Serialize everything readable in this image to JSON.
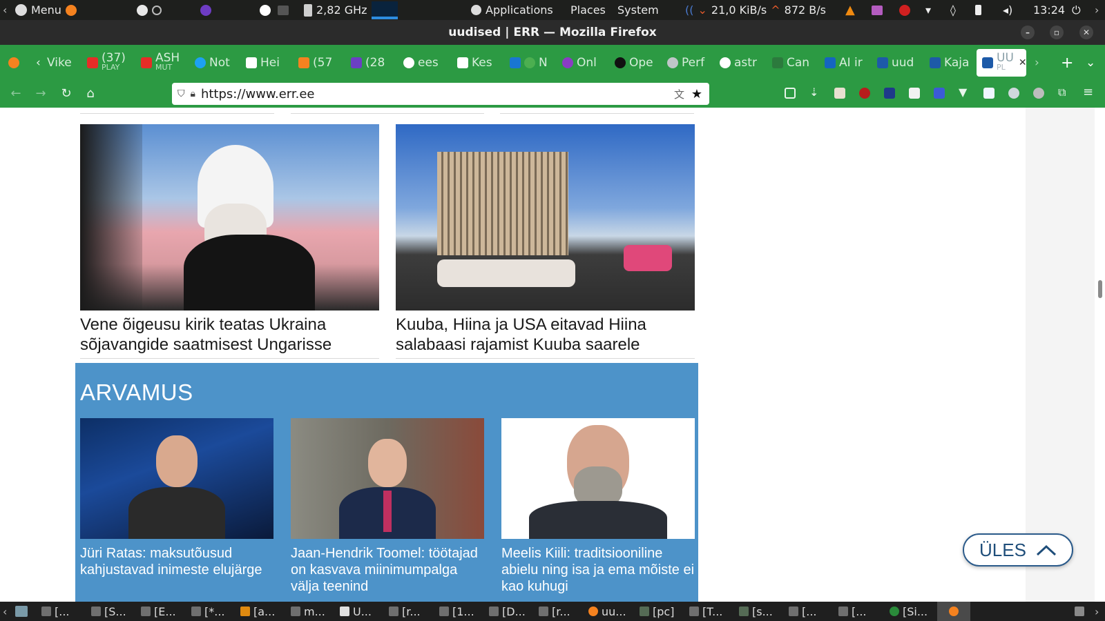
{
  "system_panel": {
    "menu_label": "Menu",
    "cpu_freq": "2,82 GHz",
    "applications_label": "Applications",
    "places_label": "Places",
    "system_label": "System",
    "net_down": "21,0 KiB/s",
    "net_up": "872 B/s",
    "clock": "13:24"
  },
  "window": {
    "title": "uudised | ERR — Mozilla Firefox"
  },
  "tabs": [
    {
      "label": "Vike",
      "icon": "back-chevron"
    },
    {
      "label": "(37)",
      "sub": "PLAY",
      "icon": "youtube-icon",
      "color": "#e52d27"
    },
    {
      "label": "ASH",
      "sub": "MUT",
      "icon": "youtube-icon",
      "color": "#e52d27"
    },
    {
      "label": "Not",
      "icon": "twitter-icon",
      "color": "#1da1f2"
    },
    {
      "label": "Hei",
      "icon": "wikipedia-icon",
      "color": "#ffffff"
    },
    {
      "label": "(57",
      "icon": "fox-icon",
      "color": "#f58220"
    },
    {
      "label": "(28",
      "icon": "mail-icon",
      "color": "#6b3fc4"
    },
    {
      "label": "ees",
      "icon": "google-icon",
      "color": "#ffffff"
    },
    {
      "label": "Kes",
      "icon": "sheet-icon",
      "color": "#ffffff"
    },
    {
      "label": "N",
      "icon": "r-icon",
      "color": "#1976d2"
    },
    {
      "label": "Onl",
      "icon": "cloud-icon",
      "color": "#8a3cc4"
    },
    {
      "label": "Ope",
      "icon": "openai-icon",
      "color": "#111111"
    },
    {
      "label": "Perf",
      "icon": "perf-icon",
      "color": "#bfc6c8"
    },
    {
      "label": "astr",
      "icon": "google-icon",
      "color": "#ffffff"
    },
    {
      "label": "Can",
      "icon": "dots-icon",
      "color": "#2c7a3d"
    },
    {
      "label": "AI ir",
      "icon": "doc-icon",
      "color": "#1565c0"
    },
    {
      "label": "uud",
      "icon": "err-icon",
      "color": "#1d5aa8"
    },
    {
      "label": "Kaja",
      "icon": "err-icon",
      "color": "#1d5aa8"
    },
    {
      "label": "UU",
      "sub": "PL",
      "icon": "err-icon",
      "color": "#1d5aa8",
      "active": true
    }
  ],
  "nav": {
    "url": "https://www.err.ee"
  },
  "articles": [
    {
      "headline": "Vene õigeusu kirik teatas Ukraina sõjavangide saatmisest Ungarisse"
    },
    {
      "headline": "Kuuba, Hiina ja USA eitavad Hiina salabaasi rajamist Kuuba saarele"
    }
  ],
  "opinion": {
    "title": "ARVAMUS",
    "items": [
      {
        "headline": "Jüri Ratas: maksutõusud kahjustavad inimeste elujärge"
      },
      {
        "headline": "Jaan-Hendrik Toomel: töötajad on kasvava miinimumpalga välja teenind"
      },
      {
        "headline": "Meelis Kiili: traditsiooniline abielu ning isa ja ema mõiste ei kao kuhugi"
      }
    ]
  },
  "up_button": {
    "label": "ÜLES"
  },
  "taskbar": [
    {
      "label": "[..."
    },
    {
      "label": "[S..."
    },
    {
      "label": "[E..."
    },
    {
      "label": "[*..."
    },
    {
      "label": "[a..."
    },
    {
      "label": "m..."
    },
    {
      "label": "U..."
    },
    {
      "label": "[r..."
    },
    {
      "label": "[1..."
    },
    {
      "label": "[D..."
    },
    {
      "label": "[r..."
    },
    {
      "label": "uu..."
    },
    {
      "label": "[pc]"
    },
    {
      "label": "[T..."
    },
    {
      "label": "[s..."
    },
    {
      "label": "[..."
    },
    {
      "label": "[..."
    },
    {
      "label": "[Si..."
    }
  ]
}
